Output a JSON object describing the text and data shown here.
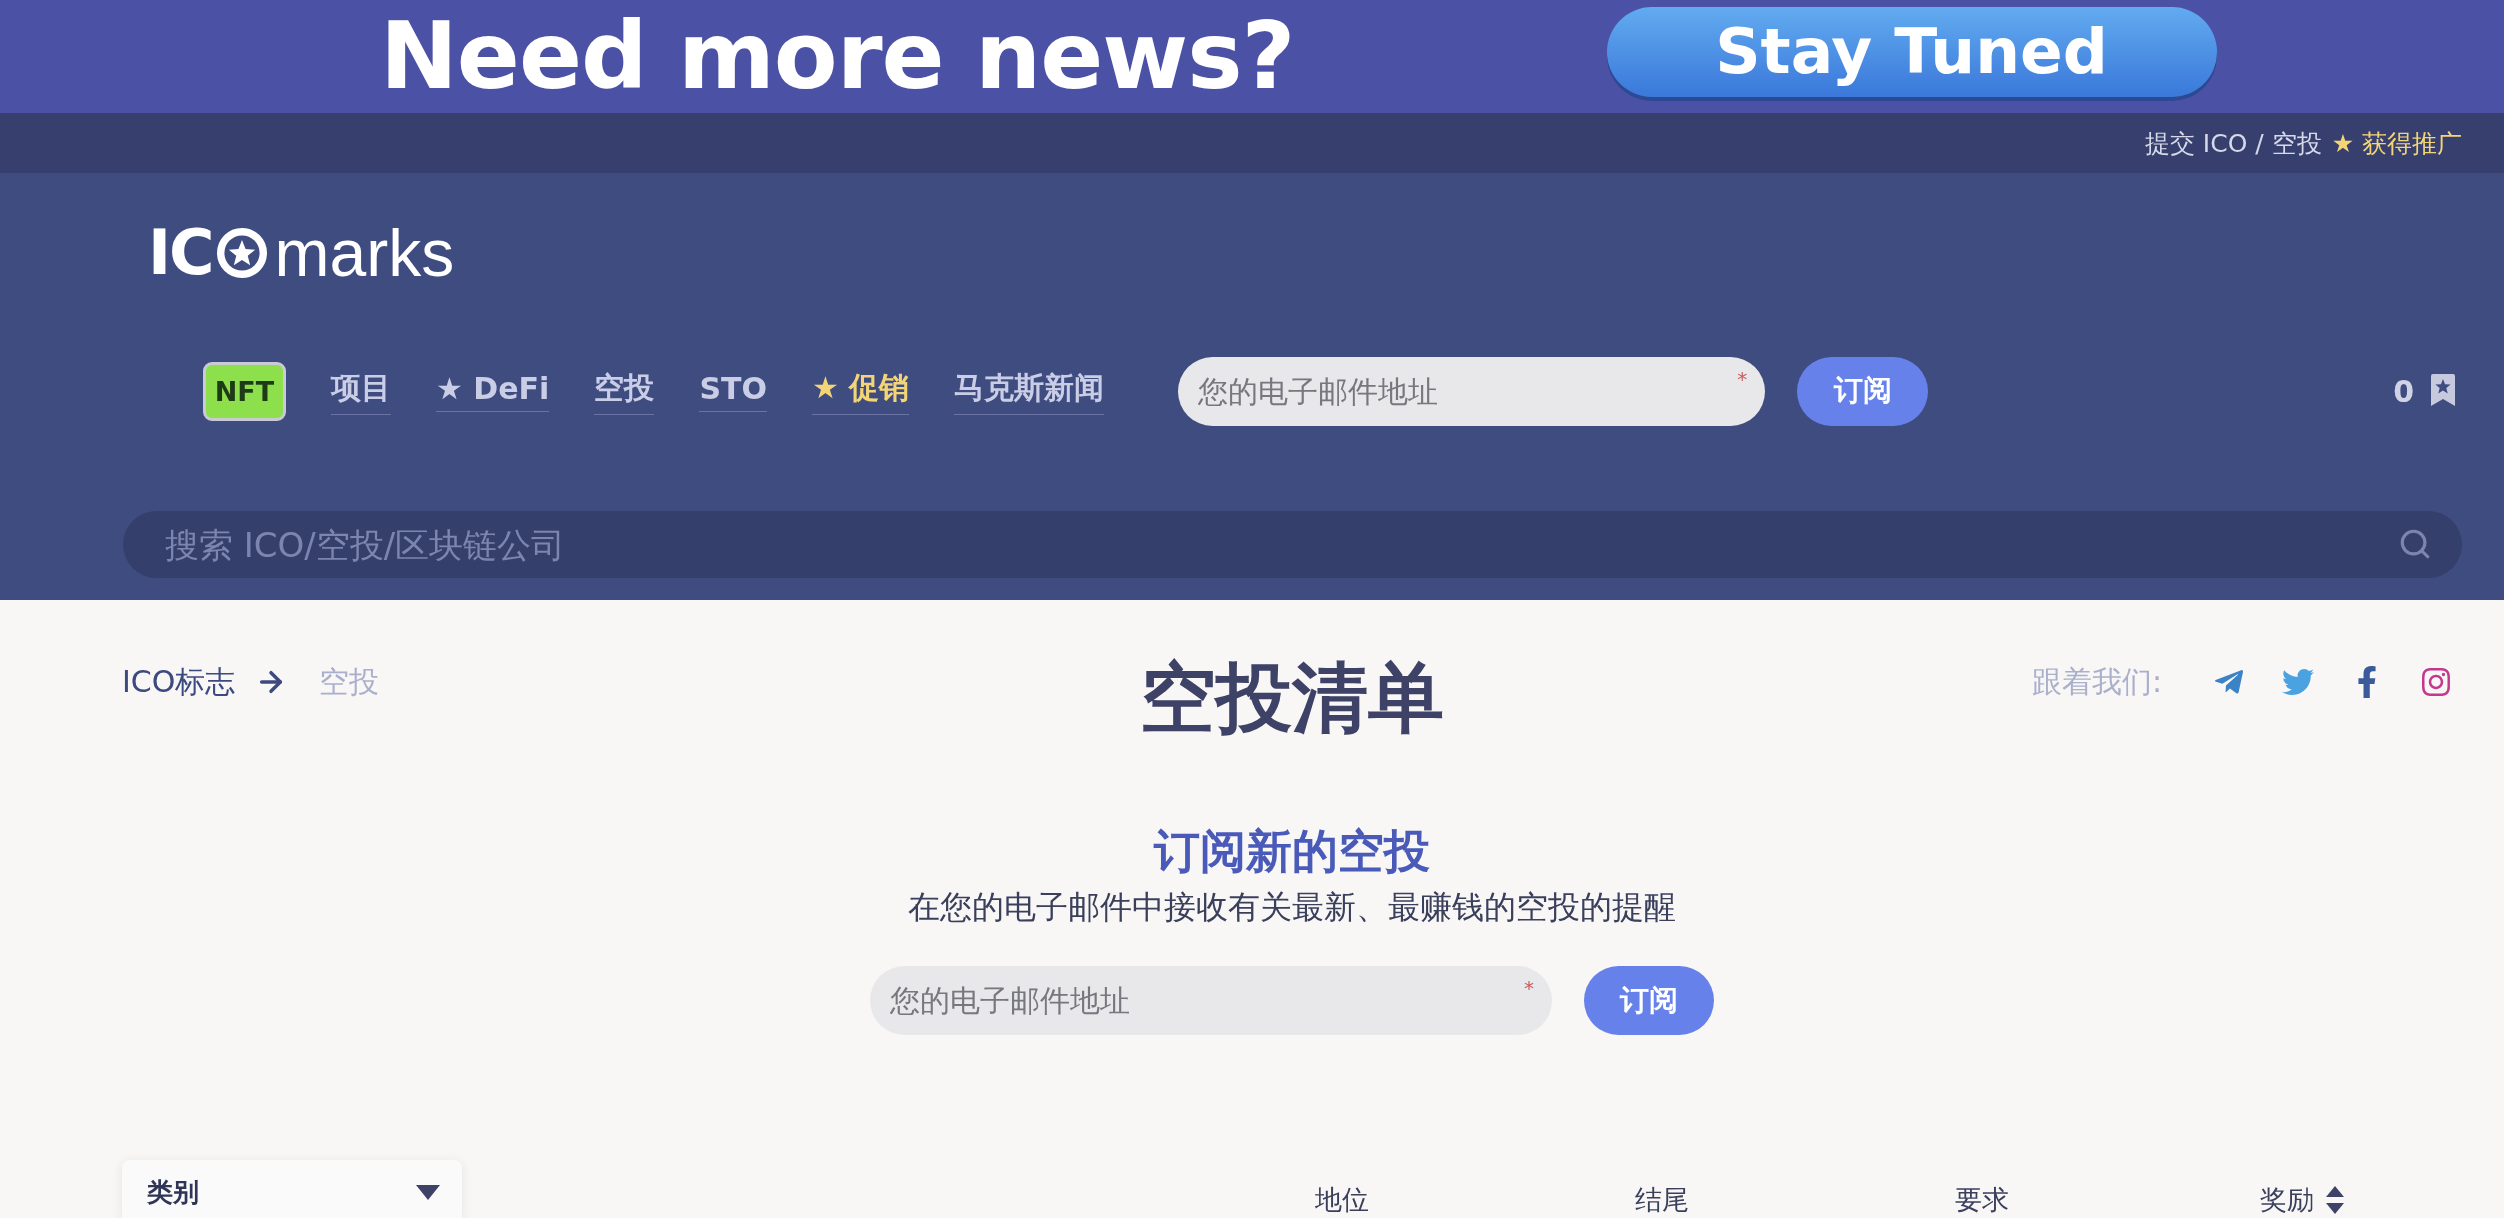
{
  "banner": {
    "headline": "Need more news?",
    "button": "Stay Tuned"
  },
  "top_bar": {
    "links": [
      {
        "text": "提交 ICO / 空投",
        "kind": "plain"
      },
      {
        "text": "★ 获得推广",
        "kind": "promo"
      }
    ]
  },
  "header": {
    "logo": {
      "prefix": "IC",
      "suffix": "marks"
    },
    "nav": [
      {
        "label": "NFT",
        "kind": "badge"
      },
      {
        "label": "项目",
        "kind": "link"
      },
      {
        "label": "★ DeFi",
        "kind": "link"
      },
      {
        "label": "空投",
        "kind": "link"
      },
      {
        "label": "STO",
        "kind": "link"
      },
      {
        "label": "★ 促销",
        "kind": "promo"
      },
      {
        "label": "马克斯新闻",
        "kind": "link"
      }
    ],
    "subscribe": {
      "placeholder": "您的电子邮件地址",
      "required_mark": "*",
      "button": "订阅"
    },
    "favorites": {
      "count": "0"
    },
    "search": {
      "placeholder": "搜索 ICO/空投/区块链公司"
    }
  },
  "breadcrumb": [
    {
      "label": "ICO标志",
      "current": false
    },
    {
      "label": "空投",
      "current": true
    }
  ],
  "page_title": "空投清单",
  "follow": {
    "label": "跟着我们:",
    "networks": [
      {
        "kind": "telegram"
      },
      {
        "kind": "twitter"
      },
      {
        "kind": "facebook"
      },
      {
        "kind": "instagram"
      }
    ]
  },
  "subscribe_section": {
    "title": "订阅新的空投",
    "subtitle": "在您的电子邮件中接收有关最新、最赚钱的空投的提醒",
    "placeholder": "您的电子邮件地址",
    "required_mark": "*",
    "button": "订阅"
  },
  "filters": {
    "category": {
      "label": "类别"
    }
  },
  "table": {
    "columns": [
      {
        "label": "地位",
        "sortable": false
      },
      {
        "label": "结尾",
        "sortable": false
      },
      {
        "label": "要求",
        "sortable": false
      },
      {
        "label": "奖励",
        "sortable": true
      }
    ]
  }
}
